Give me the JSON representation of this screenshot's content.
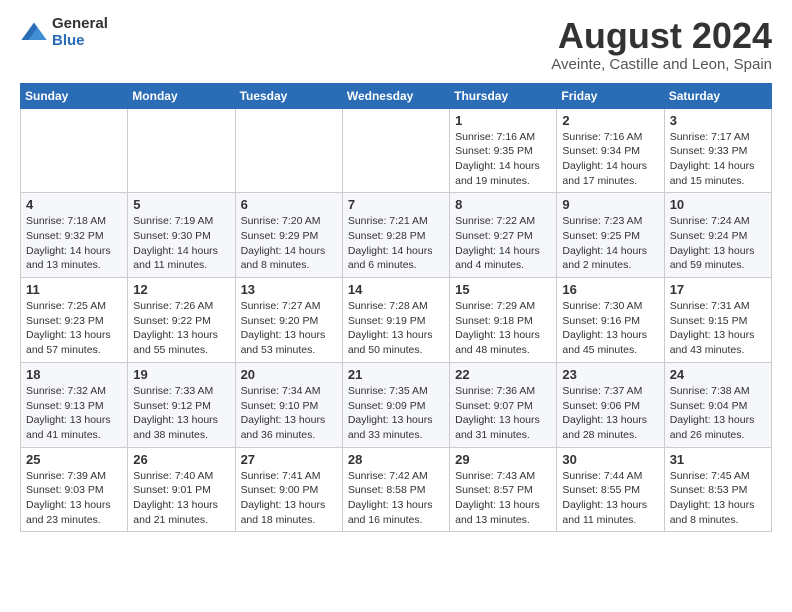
{
  "header": {
    "logo": {
      "general": "General",
      "blue": "Blue"
    },
    "title": "August 2024",
    "location": "Aveinte, Castille and Leon, Spain"
  },
  "weekdays": [
    "Sunday",
    "Monday",
    "Tuesday",
    "Wednesday",
    "Thursday",
    "Friday",
    "Saturday"
  ],
  "weeks": [
    [
      {
        "day": "",
        "info": ""
      },
      {
        "day": "",
        "info": ""
      },
      {
        "day": "",
        "info": ""
      },
      {
        "day": "",
        "info": ""
      },
      {
        "day": "1",
        "info": "Sunrise: 7:16 AM\nSunset: 9:35 PM\nDaylight: 14 hours\nand 19 minutes."
      },
      {
        "day": "2",
        "info": "Sunrise: 7:16 AM\nSunset: 9:34 PM\nDaylight: 14 hours\nand 17 minutes."
      },
      {
        "day": "3",
        "info": "Sunrise: 7:17 AM\nSunset: 9:33 PM\nDaylight: 14 hours\nand 15 minutes."
      }
    ],
    [
      {
        "day": "4",
        "info": "Sunrise: 7:18 AM\nSunset: 9:32 PM\nDaylight: 14 hours\nand 13 minutes."
      },
      {
        "day": "5",
        "info": "Sunrise: 7:19 AM\nSunset: 9:30 PM\nDaylight: 14 hours\nand 11 minutes."
      },
      {
        "day": "6",
        "info": "Sunrise: 7:20 AM\nSunset: 9:29 PM\nDaylight: 14 hours\nand 8 minutes."
      },
      {
        "day": "7",
        "info": "Sunrise: 7:21 AM\nSunset: 9:28 PM\nDaylight: 14 hours\nand 6 minutes."
      },
      {
        "day": "8",
        "info": "Sunrise: 7:22 AM\nSunset: 9:27 PM\nDaylight: 14 hours\nand 4 minutes."
      },
      {
        "day": "9",
        "info": "Sunrise: 7:23 AM\nSunset: 9:25 PM\nDaylight: 14 hours\nand 2 minutes."
      },
      {
        "day": "10",
        "info": "Sunrise: 7:24 AM\nSunset: 9:24 PM\nDaylight: 13 hours\nand 59 minutes."
      }
    ],
    [
      {
        "day": "11",
        "info": "Sunrise: 7:25 AM\nSunset: 9:23 PM\nDaylight: 13 hours\nand 57 minutes."
      },
      {
        "day": "12",
        "info": "Sunrise: 7:26 AM\nSunset: 9:22 PM\nDaylight: 13 hours\nand 55 minutes."
      },
      {
        "day": "13",
        "info": "Sunrise: 7:27 AM\nSunset: 9:20 PM\nDaylight: 13 hours\nand 53 minutes."
      },
      {
        "day": "14",
        "info": "Sunrise: 7:28 AM\nSunset: 9:19 PM\nDaylight: 13 hours\nand 50 minutes."
      },
      {
        "day": "15",
        "info": "Sunrise: 7:29 AM\nSunset: 9:18 PM\nDaylight: 13 hours\nand 48 minutes."
      },
      {
        "day": "16",
        "info": "Sunrise: 7:30 AM\nSunset: 9:16 PM\nDaylight: 13 hours\nand 45 minutes."
      },
      {
        "day": "17",
        "info": "Sunrise: 7:31 AM\nSunset: 9:15 PM\nDaylight: 13 hours\nand 43 minutes."
      }
    ],
    [
      {
        "day": "18",
        "info": "Sunrise: 7:32 AM\nSunset: 9:13 PM\nDaylight: 13 hours\nand 41 minutes."
      },
      {
        "day": "19",
        "info": "Sunrise: 7:33 AM\nSunset: 9:12 PM\nDaylight: 13 hours\nand 38 minutes."
      },
      {
        "day": "20",
        "info": "Sunrise: 7:34 AM\nSunset: 9:10 PM\nDaylight: 13 hours\nand 36 minutes."
      },
      {
        "day": "21",
        "info": "Sunrise: 7:35 AM\nSunset: 9:09 PM\nDaylight: 13 hours\nand 33 minutes."
      },
      {
        "day": "22",
        "info": "Sunrise: 7:36 AM\nSunset: 9:07 PM\nDaylight: 13 hours\nand 31 minutes."
      },
      {
        "day": "23",
        "info": "Sunrise: 7:37 AM\nSunset: 9:06 PM\nDaylight: 13 hours\nand 28 minutes."
      },
      {
        "day": "24",
        "info": "Sunrise: 7:38 AM\nSunset: 9:04 PM\nDaylight: 13 hours\nand 26 minutes."
      }
    ],
    [
      {
        "day": "25",
        "info": "Sunrise: 7:39 AM\nSunset: 9:03 PM\nDaylight: 13 hours\nand 23 minutes."
      },
      {
        "day": "26",
        "info": "Sunrise: 7:40 AM\nSunset: 9:01 PM\nDaylight: 13 hours\nand 21 minutes."
      },
      {
        "day": "27",
        "info": "Sunrise: 7:41 AM\nSunset: 9:00 PM\nDaylight: 13 hours\nand 18 minutes."
      },
      {
        "day": "28",
        "info": "Sunrise: 7:42 AM\nSunset: 8:58 PM\nDaylight: 13 hours\nand 16 minutes."
      },
      {
        "day": "29",
        "info": "Sunrise: 7:43 AM\nSunset: 8:57 PM\nDaylight: 13 hours\nand 13 minutes."
      },
      {
        "day": "30",
        "info": "Sunrise: 7:44 AM\nSunset: 8:55 PM\nDaylight: 13 hours\nand 11 minutes."
      },
      {
        "day": "31",
        "info": "Sunrise: 7:45 AM\nSunset: 8:53 PM\nDaylight: 13 hours\nand 8 minutes."
      }
    ]
  ]
}
